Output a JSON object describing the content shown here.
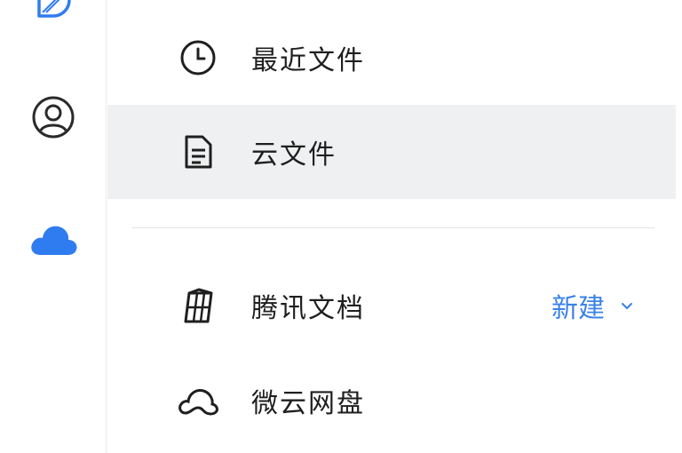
{
  "sidebar": {
    "icons": [
      {
        "name": "drive-icon"
      },
      {
        "name": "contacts-icon"
      },
      {
        "name": "cloud-icon"
      }
    ]
  },
  "nav": {
    "items": [
      {
        "label": "最近文件",
        "icon": "clock-icon"
      },
      {
        "label": "云文件",
        "icon": "document-icon",
        "selected": true
      },
      {
        "label": "腾讯文档",
        "icon": "tencent-docs-icon"
      },
      {
        "label": "微云网盘",
        "icon": "weiyun-icon"
      }
    ],
    "new_label": "新建"
  },
  "colors": {
    "accent": "#3b82e6",
    "selected_bg": "#eff0f1",
    "text": "#1f1f1f",
    "cloud_blue": "#2f7cf0"
  }
}
